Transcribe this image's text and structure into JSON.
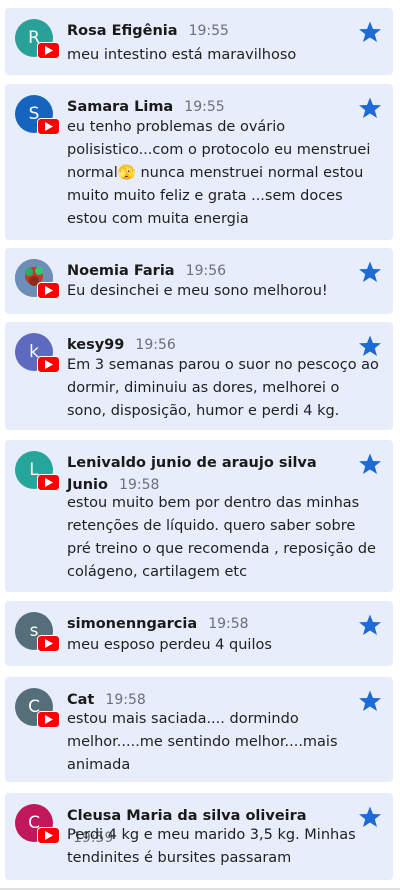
{
  "colors": {
    "card_bg": "#e8edfb",
    "star": "#1e6bd6",
    "youtube": "#ff0000"
  },
  "comments": [
    {
      "author": "Rosa Efigênia",
      "time": "19:55",
      "avatar_letter": "R",
      "avatar_color": "#2aa198",
      "avatar_icon": "letter",
      "text": "meu intestino está maravilhoso",
      "starred": true
    },
    {
      "author": "Samara Lima",
      "time": "19:55",
      "avatar_letter": "S",
      "avatar_color": "#1565c0",
      "avatar_icon": "letter",
      "text": "eu tenho problemas de ovário polisistico...com o protocolo eu menstruei normal🫣 nunca menstruei normal estou muito muito feliz e grata ...sem doces estou com muita energia",
      "starred": true
    },
    {
      "author": "Noemia Faria",
      "time": "19:56",
      "avatar_letter": "",
      "avatar_color": "#5b7fa6",
      "avatar_icon": "photo",
      "text": "Eu desinchei e meu sono melhorou!",
      "starred": true
    },
    {
      "author": "kesy99",
      "time": "19:56",
      "avatar_letter": "k",
      "avatar_color": "#5c6bc0",
      "avatar_icon": "letter",
      "text": "Em 3 semanas parou o suor no pescoço ao dormir, diminuiu as dores, melhorei o sono, disposição, humor e perdi 4 kg.",
      "starred": true
    },
    {
      "author": "Lenivaldo junio de araujo silva Junio",
      "time": "19:58",
      "avatar_letter": "L",
      "avatar_color": "#26a69a",
      "avatar_icon": "letter",
      "text": "estou muito bem por dentro das minhas retenções de líquido. quero saber sobre pré treino o que recomenda , reposição de colágeno, cartilagem etc",
      "starred": true
    },
    {
      "author": "simonenngarcia",
      "time": "19:58",
      "avatar_letter": "s",
      "avatar_color": "#546e7a",
      "avatar_icon": "letter",
      "text": "meu esposo perdeu 4 quilos",
      "starred": true
    },
    {
      "author": "Cat",
      "time": "19:58",
      "avatar_letter": "C",
      "avatar_color": "#546e7a",
      "avatar_icon": "letter",
      "text": "estou mais saciada.... dormindo melhor.....me sentindo melhor....mais animada",
      "starred": true
    },
    {
      "author": "Cleusa Maria da silva oliveira",
      "time": "19:59",
      "avatar_letter": "C",
      "avatar_color": "#c2185b",
      "avatar_icon": "letter",
      "text": "Perdi 4 kg e meu marido 3,5 kg. Minhas tendinites é bursites passaram",
      "starred": true
    }
  ]
}
